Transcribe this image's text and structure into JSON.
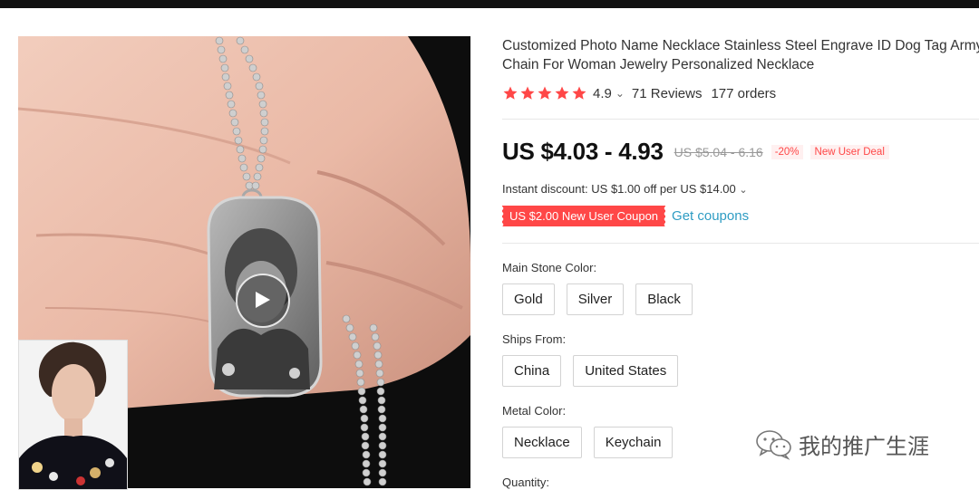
{
  "product": {
    "title": "Customized Photo Name Necklace Stainless Steel Engrave ID Dog Tag Army Chain For Woman Jewelry Personalized Necklace",
    "rating": "4.9",
    "rating_chevron": "⌄",
    "reviews": "71 Reviews",
    "orders": "177 orders",
    "stars": 5,
    "star_color": "#ff4747"
  },
  "price": {
    "current": "US $4.03 - 4.93",
    "original": "US $5.04 - 6.16",
    "discount": "-20%",
    "deal": "New User Deal"
  },
  "promo": {
    "instant_discount": "Instant discount: US $1.00 off per US $14.00",
    "instant_chevron": "⌄",
    "coupon": "US $2.00 New User Coupon",
    "get_coupons": "Get coupons",
    "link_color": "#2e9cc3"
  },
  "options": {
    "main_stone": {
      "label": "Main Stone Color:",
      "values": [
        "Gold",
        "Silver",
        "Black"
      ]
    },
    "ships_from": {
      "label": "Ships From:",
      "values": [
        "China",
        "United States"
      ]
    },
    "metal_color": {
      "label": "Metal Color:",
      "values": [
        "Necklace",
        "Keychain"
      ]
    },
    "quantity_label": "Quantity:"
  },
  "watermark": {
    "text": "我的推广生涯",
    "icon": "wechat-icon"
  },
  "gallery": {
    "play_icon": "play-icon"
  }
}
